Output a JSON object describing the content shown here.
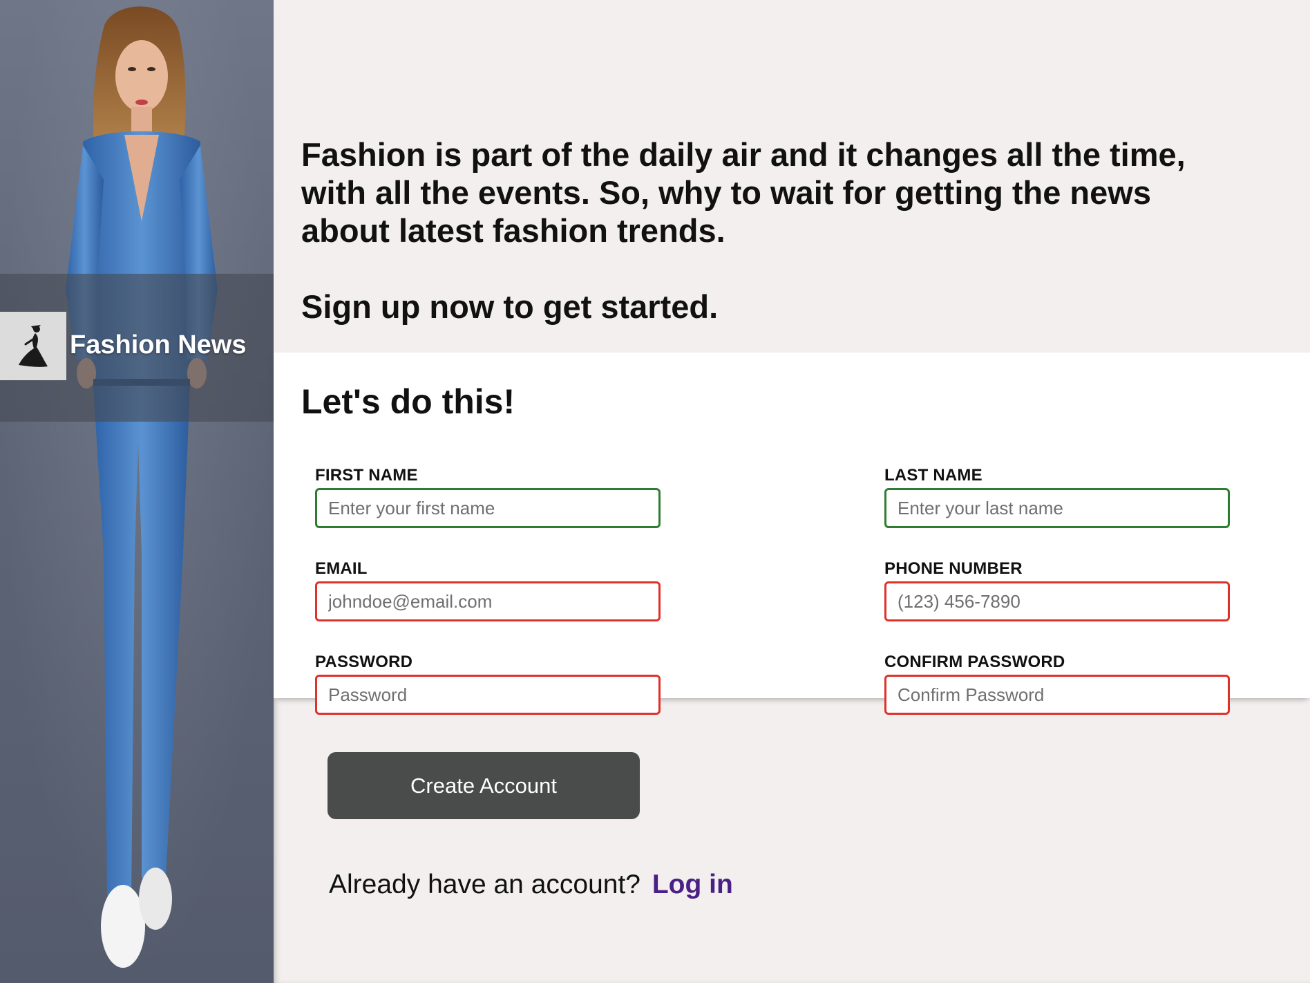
{
  "brand": {
    "name": "Fashion News",
    "logo_icon": "dancer-icon"
  },
  "intro": {
    "tagline": "Fashion is part of the daily air and it changes all the time, with all the events. So, why to wait for getting the news about latest fashion trends.",
    "cta": "Sign up now to get started."
  },
  "form": {
    "title": "Let's do this!",
    "fields": {
      "first_name": {
        "label": "FIRST NAME",
        "placeholder": "Enter your first name",
        "state": "valid"
      },
      "last_name": {
        "label": "LAST NAME",
        "placeholder": "Enter your last name",
        "state": "valid"
      },
      "email": {
        "label": "EMAIL",
        "placeholder": "johndoe@email.com",
        "state": "invalid"
      },
      "phone": {
        "label": "PHONE NUMBER",
        "placeholder": "(123) 456-7890",
        "state": "invalid"
      },
      "password": {
        "label": "PASSWORD",
        "placeholder": "Password",
        "state": "invalid"
      },
      "confirm_password": {
        "label": "CONFIRM PASSWORD",
        "placeholder": "Confirm Password",
        "state": "invalid"
      }
    },
    "submit_label": "Create Account",
    "login_prompt": "Already have an account?",
    "login_link": "Log in"
  },
  "colors": {
    "valid_border": "#2e7d32",
    "invalid_border": "#e0302a",
    "button_bg": "#4a4b4b",
    "link": "#4a1f86",
    "page_bg": "#f2efee"
  }
}
